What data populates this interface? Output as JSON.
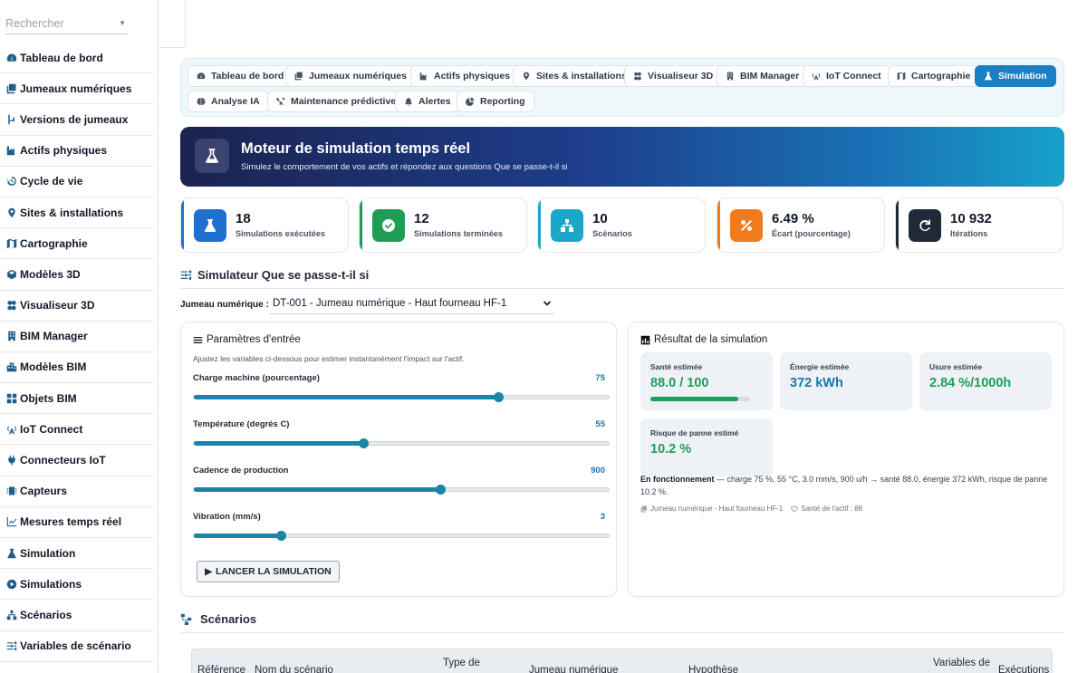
{
  "sidebar": {
    "search_placeholder": "Rechercher",
    "items": [
      {
        "label": "Tableau de bord",
        "icon": "gauge-icon"
      },
      {
        "label": "Jumeaux numériques",
        "icon": "copy-icon"
      },
      {
        "label": "Versions de jumeaux",
        "icon": "branch-icon"
      },
      {
        "label": "Actifs physiques",
        "icon": "industry-icon"
      },
      {
        "label": "Cycle de vie",
        "icon": "history-icon"
      },
      {
        "label": "Sites & installations",
        "icon": "map-pin-icon"
      },
      {
        "label": "Cartographie",
        "icon": "map-icon"
      },
      {
        "label": "Modèles 3D",
        "icon": "cube-icon"
      },
      {
        "label": "Visualiseur 3D",
        "icon": "cubes-icon"
      },
      {
        "label": "BIM Manager",
        "icon": "building-icon"
      },
      {
        "label": "Modèles BIM",
        "icon": "city-icon"
      },
      {
        "label": "Objets BIM",
        "icon": "grid-icon"
      },
      {
        "label": "IoT Connect",
        "icon": "tower-icon"
      },
      {
        "label": "Connecteurs IoT",
        "icon": "plug-icon"
      },
      {
        "label": "Capteurs",
        "icon": "microchip-icon"
      },
      {
        "label": "Mesures temps réel",
        "icon": "chart-line-icon"
      },
      {
        "label": "Simulation",
        "icon": "flask-icon"
      },
      {
        "label": "Simulations",
        "icon": "play-circle-icon"
      },
      {
        "label": "Scénarios",
        "icon": "sitemap-icon"
      },
      {
        "label": "Variables de scénario",
        "icon": "sliders-icon"
      }
    ]
  },
  "tabs": [
    {
      "label": "Tableau de bord",
      "icon": "gauge-icon",
      "active": false
    },
    {
      "label": "Jumeaux numériques",
      "icon": "copy-icon",
      "active": false
    },
    {
      "label": "Actifs physiques",
      "icon": "industry-icon",
      "active": false
    },
    {
      "label": "Sites & installations",
      "icon": "map-pin-icon",
      "active": false
    },
    {
      "label": "Visualiseur 3D",
      "icon": "cubes-icon",
      "active": false
    },
    {
      "label": "BIM Manager",
      "icon": "building-icon",
      "active": false
    },
    {
      "label": "IoT Connect",
      "icon": "tower-icon",
      "active": false
    },
    {
      "label": "Cartographie",
      "icon": "map-icon",
      "active": false
    },
    {
      "label": "Simulation",
      "icon": "flask-icon",
      "active": true
    },
    {
      "label": "Analyse IA",
      "icon": "brain-icon",
      "active": false
    },
    {
      "label": "Maintenance prédictive",
      "icon": "tools-icon",
      "active": false
    },
    {
      "label": "Alertes",
      "icon": "bell-icon",
      "active": false
    },
    {
      "label": "Reporting",
      "icon": "pie-chart-icon",
      "active": false
    }
  ],
  "hero": {
    "title": "Moteur de simulation temps réel",
    "subtitle": "Simulez le comportement de vos actifs et répondez aux questions Que se passe-t-il si"
  },
  "stats": [
    {
      "value": "18",
      "label": "Simulations exécutées",
      "color": "#1f6fd1",
      "icon": "flask-icon"
    },
    {
      "value": "12",
      "label": "Simulations terminées",
      "color": "#1f9d55",
      "icon": "check-circle-icon"
    },
    {
      "value": "10",
      "label": "Scénarios",
      "color": "#1ba7c9",
      "icon": "sitemap-icon"
    },
    {
      "value": "6.49 %",
      "label": "Écart (pourcentage)",
      "color": "#f07b1d",
      "icon": "percent-icon"
    },
    {
      "value": "10 932",
      "label": "Itérations",
      "color": "#1f2937",
      "icon": "redo-icon"
    }
  ],
  "simulator": {
    "title": "Simulateur Que se passe-t-il si",
    "twin_label": "Jumeau numérique :",
    "twin_value": "DT-001 - Jumeau numérique - Haut fourneau HF-1"
  },
  "params": {
    "title": "Paramètres d'entrée",
    "subtitle": "Ajustez les variables ci-dessous pour estimer instantanément l'impact sur l'actif.",
    "sliders": [
      {
        "label": "Charge machine (pourcentage)",
        "value": "75",
        "fraction": 0.735
      },
      {
        "label": "Température (degrés C)",
        "value": "55",
        "fraction": 0.41
      },
      {
        "label": "Cadence de production",
        "value": "900",
        "fraction": 0.595
      },
      {
        "label": "Vibration (mm/s)",
        "value": "3",
        "fraction": 0.21
      }
    ],
    "run_label": "LANCER LA SIMULATION"
  },
  "result": {
    "title": "Résultat de la simulation",
    "health_label": "Santé estimée",
    "health_value": "88.0 / 100",
    "health_fraction": 0.88,
    "energy_label": "Énergie estimée",
    "energy_value": "372 kWh",
    "wear_label": "Usure estimée",
    "wear_value": "2.84 %/1000h",
    "risk_label": "Risque de panne estimé",
    "risk_value": "10.2 %",
    "status_bold": "En fonctionnement",
    "status_text": " — charge 75 %, 55 °C, 3.0 mm/s, 900 u/h → santé 88.0, énergie 372 kWh, risque de panne 10.2 %.",
    "foot_twin": "Jumeau numérique - Haut fourneau HF-1",
    "foot_health": "Santé de l'actif : 88"
  },
  "scenarios": {
    "title": "Scénarios",
    "columns": [
      "Référence",
      "Nom du scénario",
      "Type de",
      "Jumeau numérique",
      "Hypothèse",
      "Variables de",
      "Exécutions"
    ]
  }
}
